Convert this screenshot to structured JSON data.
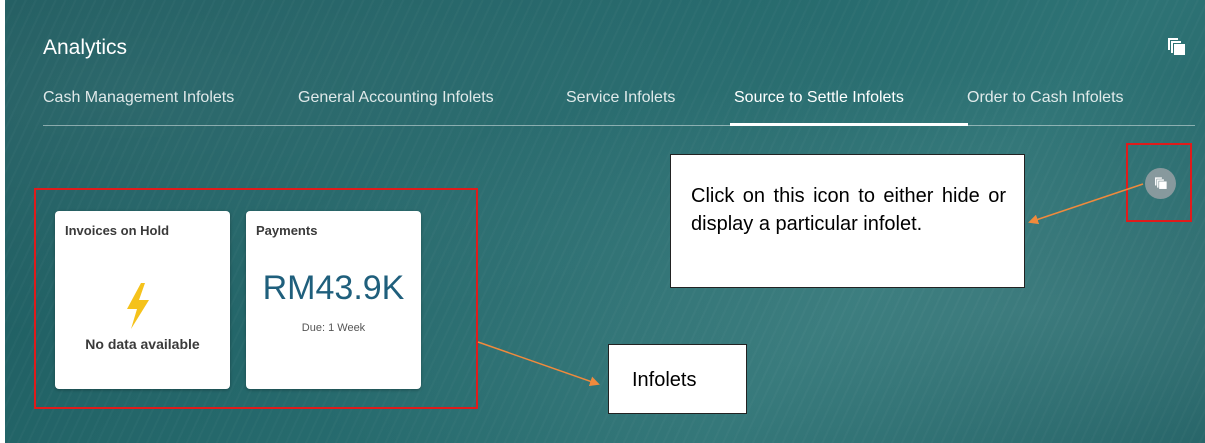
{
  "page": {
    "title": "Analytics"
  },
  "tabs": [
    {
      "label": "Cash Management Infolets",
      "active": false
    },
    {
      "label": "General Accounting Infolets",
      "active": false
    },
    {
      "label": "Service Infolets",
      "active": false
    },
    {
      "label": "Source to Settle Infolets",
      "active": true
    },
    {
      "label": "Order to Cash Infolets",
      "active": false
    }
  ],
  "icons": {
    "top_right": "manage-infolets-icon",
    "overlay": "manage-infolets-icon"
  },
  "infolets": [
    {
      "title": "Invoices on Hold",
      "icon": "lightning-bolt-icon",
      "message": "No data available"
    },
    {
      "title": "Payments",
      "value": "RM43.9K",
      "caption": "Due: 1 Week"
    }
  ],
  "annotations": {
    "icon_callout": "Click on this icon to either hide or display a particular infolet.",
    "infolets_callout": "Infolets"
  },
  "colors": {
    "background": "#266a6d",
    "highlight_border": "#e01b1b",
    "arrow": "#f08a3c",
    "amount_text": "#1f5f7c",
    "bolt": "#f5c21b"
  }
}
